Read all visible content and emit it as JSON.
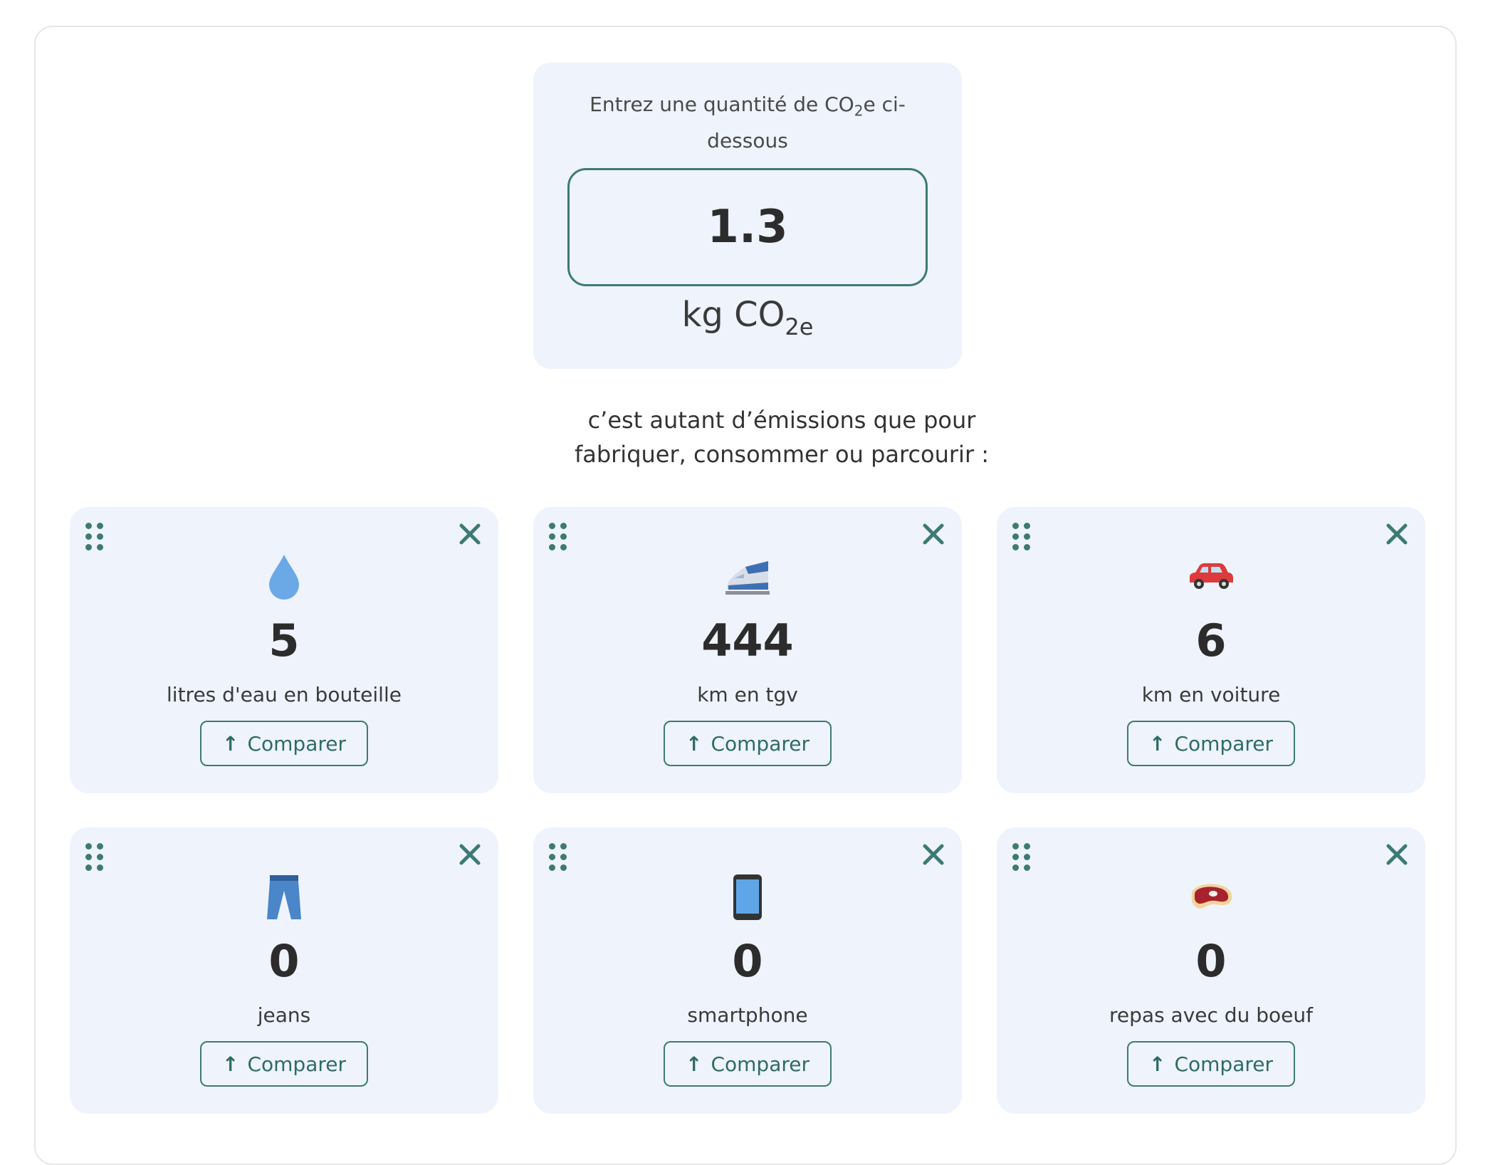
{
  "input": {
    "prompt_before": "Entrez une quantité de CO",
    "prompt_sub": "2",
    "prompt_after": "e ci-dessous",
    "value": "1.3",
    "unit_main": "kg CO",
    "unit_sub": "2e"
  },
  "subtitle": "c’est autant d’émissions que pour fabriquer, consommer ou parcourir :",
  "cards": [
    {
      "icon": "water-drop-icon",
      "value": "5",
      "label": "litres d'eau en bouteille",
      "button": "Comparer"
    },
    {
      "icon": "train-tgv-icon",
      "value": "444",
      "label": "km en tgv",
      "button": "Comparer"
    },
    {
      "icon": "car-icon",
      "value": "6",
      "label": "km en voiture",
      "button": "Comparer"
    },
    {
      "icon": "jeans-icon",
      "value": "0",
      "label": "jeans",
      "button": "Comparer"
    },
    {
      "icon": "smartphone-icon",
      "value": "0",
      "label": "smartphone",
      "button": "Comparer"
    },
    {
      "icon": "beef-meal-icon",
      "value": "0",
      "label": "repas avec du boeuf",
      "button": "Comparer"
    }
  ],
  "colors": {
    "accent": "#3d7a75",
    "card_bg": "#eef3fc",
    "text": "#3a3a3a"
  }
}
